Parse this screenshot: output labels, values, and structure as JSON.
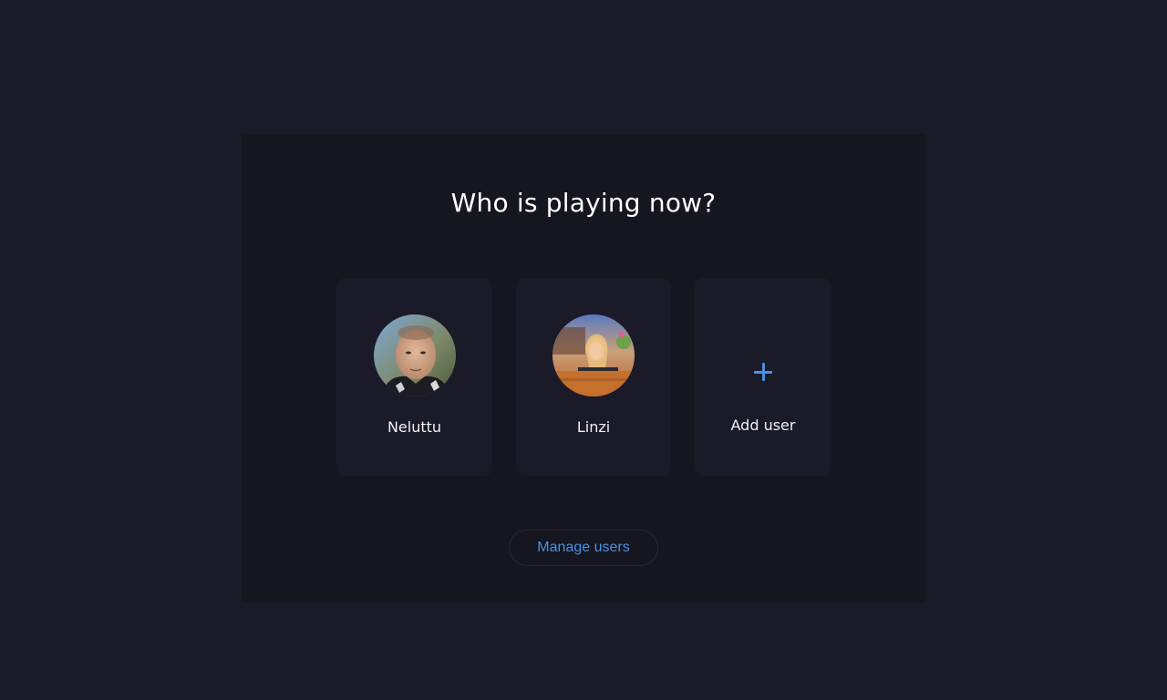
{
  "title": "Who is playing now?",
  "users": [
    {
      "name": "Neluttu",
      "avatar_icon": "user-photo-neluttu"
    },
    {
      "name": "Linzi",
      "avatar_icon": "user-photo-linzi"
    }
  ],
  "add_user": {
    "label": "Add user",
    "icon": "plus-icon"
  },
  "manage_users_label": "Manage users",
  "colors": {
    "background": "#1b1a29",
    "panel": "#161620",
    "card": "#1b1a29",
    "accent": "#4a90e2",
    "text": "#ffffff"
  }
}
